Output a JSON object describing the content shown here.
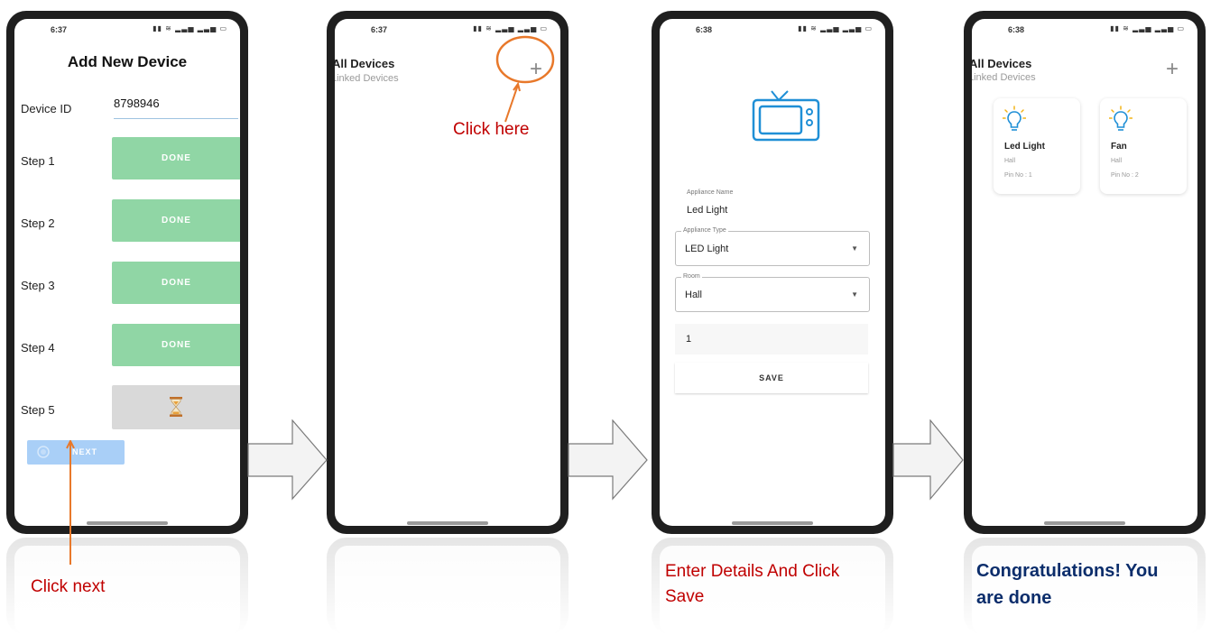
{
  "colors": {
    "done_green": "#90d6a5",
    "next_blue": "#a9cff7",
    "annotation_orange": "#e8782a",
    "annotation_red": "#c00000",
    "annotation_blue": "#0b2d6b",
    "tv_icon_blue": "#1f8fd6"
  },
  "phone1": {
    "time": "6:37",
    "status_icons": "signal-wifi-battery",
    "title": "Add New Device",
    "device_id_label": "Device ID",
    "device_id_value": "8798946",
    "steps": [
      {
        "label": "Step 1",
        "button": "DONE"
      },
      {
        "label": "Step 2",
        "button": "DONE"
      },
      {
        "label": "Step 3",
        "button": "DONE"
      },
      {
        "label": "Step 4",
        "button": "DONE"
      },
      {
        "label": "Step 5",
        "button_icon": "hourglass-icon"
      }
    ],
    "next_label": "NEXT",
    "annotation": "Click  next"
  },
  "phone2": {
    "time": "6:37",
    "title": "All Devices",
    "subtitle": "Linked Devices",
    "add_symbol": "+",
    "annotation": "Click here"
  },
  "phone3": {
    "time": "6:38",
    "icon": "tv-icon",
    "appliance_name_label": "Appliance Name",
    "appliance_name_value": "Led Light",
    "appliance_type_label": "Appliance Type",
    "appliance_type_value": "LED Light",
    "room_label": "Room",
    "room_value": "Hall",
    "pin_value": "1",
    "save_label": "SAVE",
    "annotation_line1": "Enter Details And Click",
    "annotation_line2": "Save"
  },
  "phone4": {
    "time": "6:38",
    "title": "All Devices",
    "subtitle": "Linked Devices",
    "add_symbol": "+",
    "devices": [
      {
        "name": "Led Light",
        "room": "Hall",
        "pin": "Pin No : 1",
        "icon": "bulb-icon"
      },
      {
        "name": "Fan",
        "room": "Hall",
        "pin": "Pin No : 2",
        "icon": "bulb-icon"
      }
    ],
    "annotation_line1": "Congratulations! You",
    "annotation_line2": "are done"
  }
}
